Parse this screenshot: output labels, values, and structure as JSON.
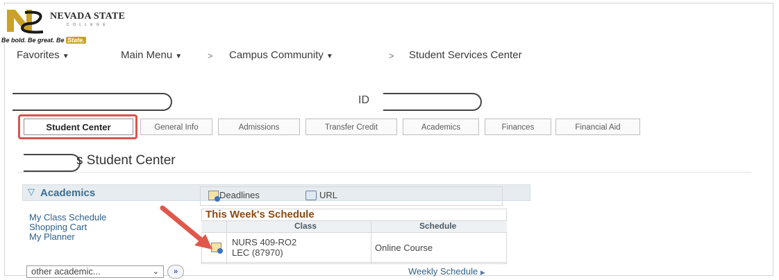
{
  "branding": {
    "name": "NEVADA STATE",
    "sub": "C O L L E G E",
    "tagline_start": "Be bold. Be great. Be ",
    "tagline_highlight": "State."
  },
  "breadcrumb": {
    "favorites": "Favorites",
    "main_menu": "Main Menu",
    "campus_community": "Campus Community",
    "current": "Student Services Center"
  },
  "id_label": "ID",
  "tabs": [
    {
      "label": "Student Center"
    },
    {
      "label": "General Info"
    },
    {
      "label": "Admissions"
    },
    {
      "label": "Transfer Credit"
    },
    {
      "label": "Academics"
    },
    {
      "label": "Finances"
    },
    {
      "label": "Financial Aid"
    }
  ],
  "page_title_suffix": "s Student Center",
  "academics": {
    "title": "Academics",
    "links": [
      "My Class Schedule",
      "Shopping Cart",
      "My Planner"
    ],
    "select_value": "other academic...",
    "go_label": "»",
    "deadlines_label": "Deadlines",
    "url_label": "URL",
    "schedule_title": "This Week's Schedule",
    "columns": [
      "Class",
      "Schedule"
    ],
    "rows": [
      {
        "class_line1": "NURS 409-RO2",
        "class_line2": "LEC (87970)",
        "schedule": "Online Course"
      }
    ],
    "weekly_link": "Weekly Schedule"
  },
  "colors": {
    "highlight": "#d9534f",
    "arrow": "#e0584b",
    "link": "#2c5f8a",
    "section_title": "#3e6e94",
    "schedule_title": "#8b4a12"
  }
}
